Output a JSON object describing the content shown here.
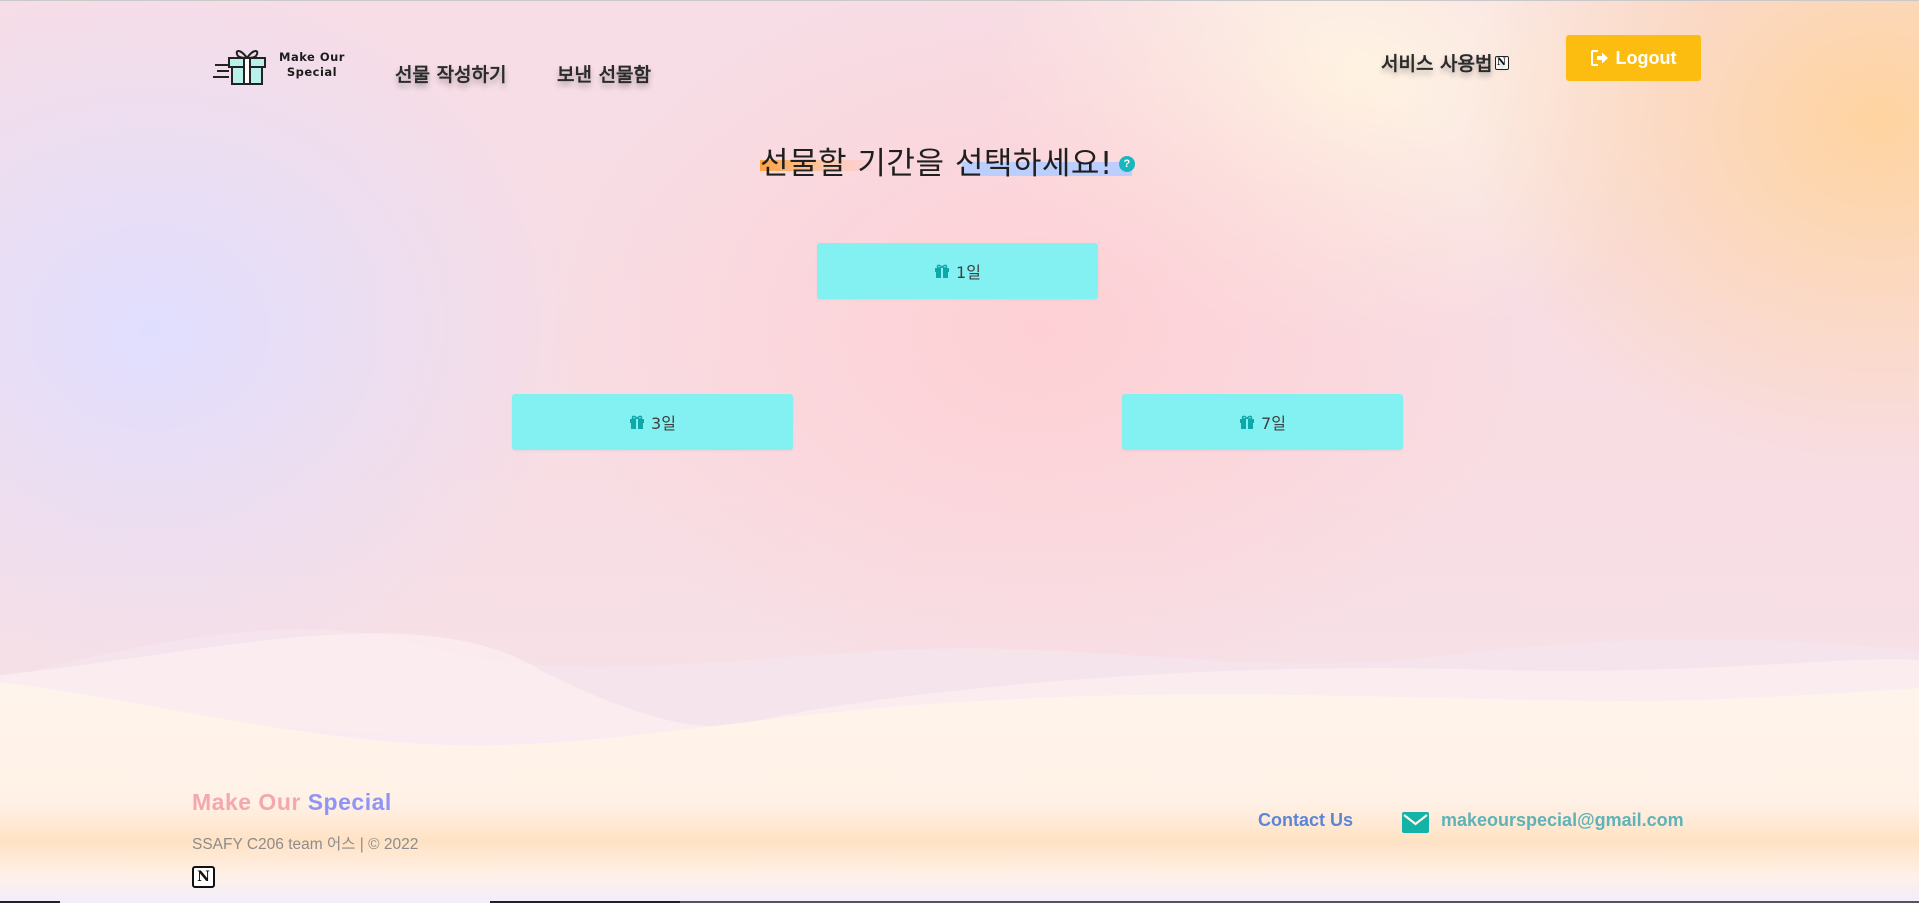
{
  "header": {
    "logo_line1": "Make Our",
    "logo_line2": "Special",
    "nav": [
      "선물 작성하기",
      "보낸 선물함"
    ],
    "guide_label": "서비스 사용법",
    "guide_icon": "N",
    "logout_label": "Logout"
  },
  "main": {
    "title": "선물할 기간을 선택하세요!",
    "help_icon": "?",
    "options": [
      {
        "label": "1일",
        "icon": "gift-icon"
      },
      {
        "label": "3일",
        "icon": "gift-icon"
      },
      {
        "label": "7일",
        "icon": "gift-icon"
      }
    ]
  },
  "footer": {
    "brand_part1": "Make Our",
    "brand_part2": "Special",
    "copyright": "SSAFY C206 team 어스 | © 2022",
    "notion_icon": "N",
    "contact_label": "Contact Us",
    "email": "makeourspecial@gmail.com"
  },
  "colors": {
    "accent_teal": "#83f1f1",
    "logout_yellow": "#fdbd10",
    "brand_pink": "#f3a8ae",
    "brand_purple": "#8f95f5",
    "contact_blue": "#5b86d8",
    "email_teal": "#5fb2b8"
  }
}
